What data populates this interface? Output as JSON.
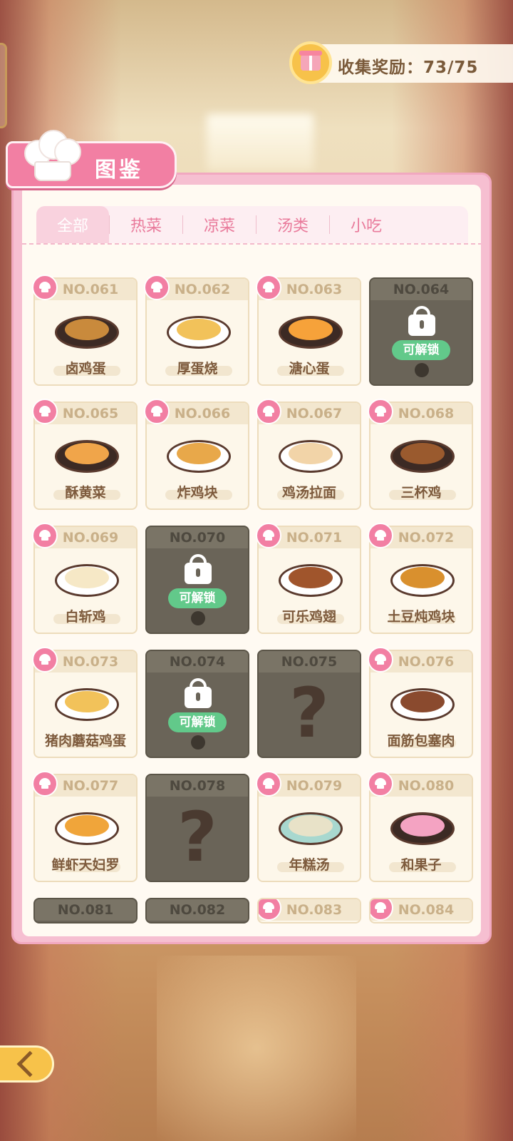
{
  "reward": {
    "label": "收集奖励：73/75",
    "icon": "gift-icon"
  },
  "header": {
    "title": "图鉴",
    "icon": "chef-hat-icon"
  },
  "tabs": [
    {
      "label": "全部",
      "active": true
    },
    {
      "label": "热菜",
      "active": false
    },
    {
      "label": "凉菜",
      "active": false
    },
    {
      "label": "汤类",
      "active": false
    },
    {
      "label": "小吃",
      "active": false
    }
  ],
  "unlock_label": "可解锁",
  "unknown_mark": "?",
  "cards": [
    {
      "no": "NO.061",
      "name": "卤鸡蛋",
      "state": "collected",
      "food_color": "#c98a3c",
      "plate": "dark"
    },
    {
      "no": "NO.062",
      "name": "厚蛋烧",
      "state": "collected",
      "food_color": "#f2c25a",
      "plate": "white"
    },
    {
      "no": "NO.063",
      "name": "溏心蛋",
      "state": "collected",
      "food_color": "#f6a23a",
      "plate": "dark"
    },
    {
      "no": "NO.064",
      "name": "",
      "state": "unlockable"
    },
    {
      "no": "NO.065",
      "name": "酥黄菜",
      "state": "collected",
      "food_color": "#f0a54a",
      "plate": "dark"
    },
    {
      "no": "NO.066",
      "name": "炸鸡块",
      "state": "collected",
      "food_color": "#e8a84a",
      "plate": "white"
    },
    {
      "no": "NO.067",
      "name": "鸡汤拉面",
      "state": "collected",
      "food_color": "#f2d4a8",
      "plate": "white"
    },
    {
      "no": "NO.068",
      "name": "三杯鸡",
      "state": "collected",
      "food_color": "#9a5a2e",
      "plate": "dark"
    },
    {
      "no": "NO.069",
      "name": "白斩鸡",
      "state": "collected",
      "food_color": "#f6e8c6",
      "plate": "white"
    },
    {
      "no": "NO.070",
      "name": "",
      "state": "unlockable"
    },
    {
      "no": "NO.071",
      "name": "可乐鸡翅",
      "state": "collected",
      "food_color": "#a0552c",
      "plate": "white"
    },
    {
      "no": "NO.072",
      "name": "土豆炖鸡块",
      "state": "collected",
      "food_color": "#d9902e",
      "plate": "white"
    },
    {
      "no": "NO.073",
      "name": "猪肉蘑菇鸡蛋",
      "state": "collected",
      "food_color": "#f2c25a",
      "plate": "white"
    },
    {
      "no": "NO.074",
      "name": "",
      "state": "unlockable"
    },
    {
      "no": "NO.075",
      "name": "",
      "state": "unknown"
    },
    {
      "no": "NO.076",
      "name": "面筋包塞肉",
      "state": "collected",
      "food_color": "#8a4a2e",
      "plate": "white"
    },
    {
      "no": "NO.077",
      "name": "鲜虾天妇罗",
      "state": "collected",
      "food_color": "#f0a53a",
      "plate": "white"
    },
    {
      "no": "NO.078",
      "name": "",
      "state": "unknown"
    },
    {
      "no": "NO.079",
      "name": "年糕汤",
      "state": "collected",
      "food_color": "#e8e2c8",
      "plate": "teal"
    },
    {
      "no": "NO.080",
      "name": "和果子",
      "state": "collected",
      "food_color": "#f4a3c2",
      "plate": "dark"
    },
    {
      "no": "NO.081",
      "name": "",
      "state": "partial-locked"
    },
    {
      "no": "NO.082",
      "name": "",
      "state": "partial-locked"
    },
    {
      "no": "NO.083",
      "name": "",
      "state": "partial"
    },
    {
      "no": "NO.084",
      "name": "",
      "state": "partial"
    }
  ],
  "colors": {
    "accent_pink": "#f27fa3",
    "unlock_green": "#62c98a",
    "gold": "#f7c24a"
  },
  "back_button": {
    "icon": "back-arrow-icon"
  }
}
